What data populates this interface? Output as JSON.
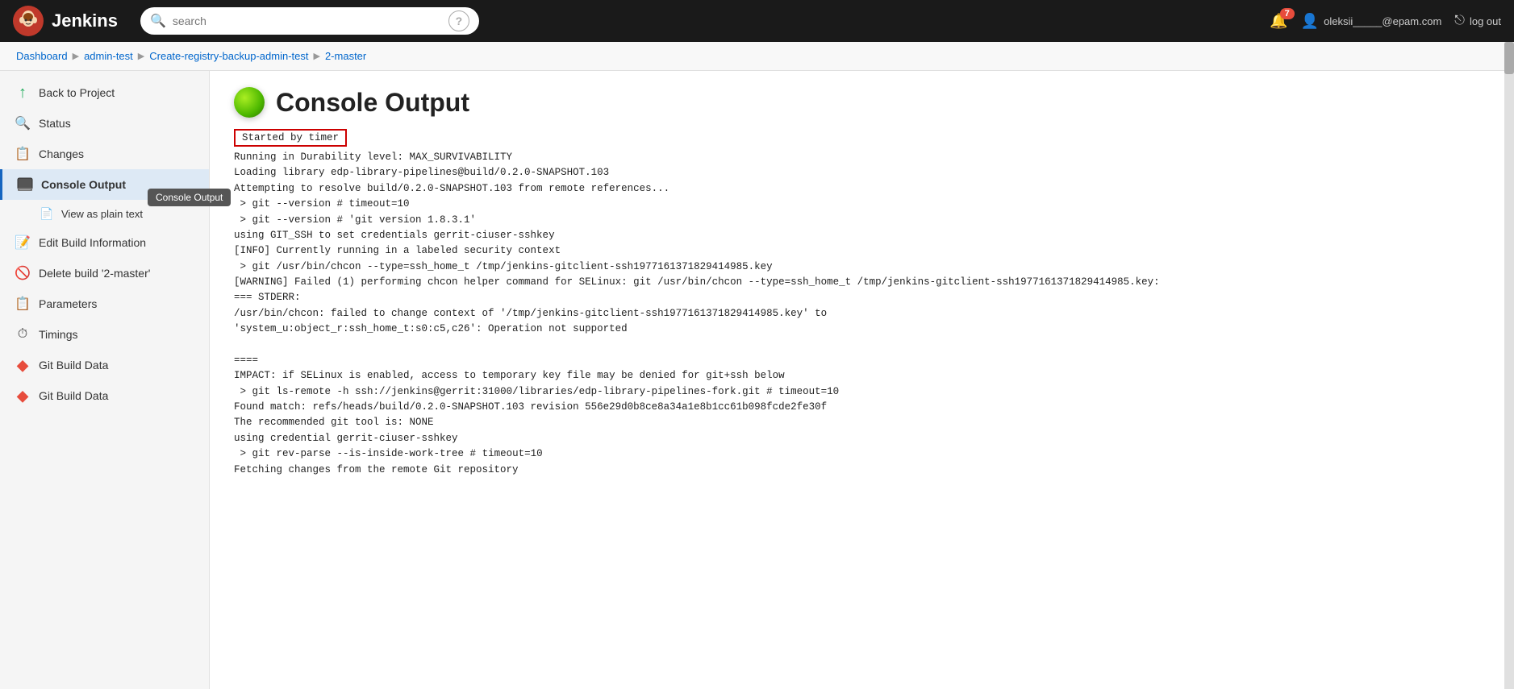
{
  "navbar": {
    "brand": "Jenkins",
    "search_placeholder": "search",
    "help_icon": "?",
    "notifications_count": "7",
    "user_display": "oleksii_____@epam.com",
    "logout_label": "log out"
  },
  "breadcrumb": {
    "items": [
      {
        "label": "Dashboard",
        "href": "#"
      },
      {
        "label": "admin-test",
        "href": "#"
      },
      {
        "label": "Create-registry-backup-admin-test",
        "href": "#"
      },
      {
        "label": "2-master",
        "href": "#"
      }
    ]
  },
  "sidebar": {
    "items": [
      {
        "id": "back-to-project",
        "label": "Back to Project",
        "icon": "↑",
        "icon_color": "#27ae60",
        "active": false
      },
      {
        "id": "status",
        "label": "Status",
        "icon": "🔍",
        "active": false
      },
      {
        "id": "changes",
        "label": "Changes",
        "icon": "📋",
        "active": false
      },
      {
        "id": "console-output",
        "label": "Console Output",
        "icon": "💻",
        "active": true
      },
      {
        "id": "view-as-plain-text",
        "label": "View as plain text",
        "icon": "📄",
        "sub": true
      },
      {
        "id": "edit-build-information",
        "label": "Edit Build Information",
        "icon": "📝",
        "active": false
      },
      {
        "id": "delete-build",
        "label": "Delete build '2-master'",
        "icon": "🚫",
        "active": false
      },
      {
        "id": "parameters",
        "label": "Parameters",
        "icon": "📋",
        "active": false
      },
      {
        "id": "timings",
        "label": "Timings",
        "icon": "⏱",
        "active": false
      },
      {
        "id": "git-build-data-1",
        "label": "Git Build Data",
        "icon": "◆",
        "icon_color": "#e74c3c",
        "active": false
      },
      {
        "id": "git-build-data-2",
        "label": "Git Build Data",
        "icon": "◆",
        "icon_color": "#e74c3c",
        "active": false
      }
    ],
    "tooltip": "Console Output"
  },
  "main": {
    "title": "Console Output",
    "started_by": "Started by timer",
    "console_lines": [
      "Running in Durability level: MAX_SURVIVABILITY",
      "Loading library edp-library-pipelines@build/0.2.0-SNAPSHOT.103",
      "Attempting to resolve build/0.2.0-SNAPSHOT.103 from remote references...",
      " > git --version # timeout=10",
      " > git --version # 'git version 1.8.3.1'",
      "using GIT_SSH to set credentials gerrit-ciuser-sshkey",
      "[INFO] Currently running in a labeled security context",
      " > git /usr/bin/chcon --type=ssh_home_t /tmp/jenkins-gitclient-ssh1977161371829414985.key",
      "[WARNING] Failed (1) performing chcon helper command for SELinux: git /usr/bin/chcon --type=ssh_home_t /tmp/jenkins-gitclient-ssh1977161371829414985.key:",
      "=== STDERR:",
      "/usr/bin/chcon: failed to change context of '/tmp/jenkins-gitclient-ssh1977161371829414985.key' to",
      "'system_u:object_r:ssh_home_t:s0:c5,c26': Operation not supported",
      "",
      "====",
      "IMPACT: if SELinux is enabled, access to temporary key file may be denied for git+ssh below",
      " > git ls-remote -h ssh://jenkins@gerrit:31000/libraries/edp-library-pipelines-fork.git # timeout=10",
      "Found match: refs/heads/build/0.2.0-SNAPSHOT.103 revision 556e29d0b8ce8a34a1e8b1cc61b098fcde2fe30f",
      "The recommended git tool is: NONE",
      "using credential gerrit-ciuser-sshkey",
      " > git rev-parse --is-inside-work-tree # timeout=10",
      "Fetching changes from the remote Git repository"
    ]
  }
}
